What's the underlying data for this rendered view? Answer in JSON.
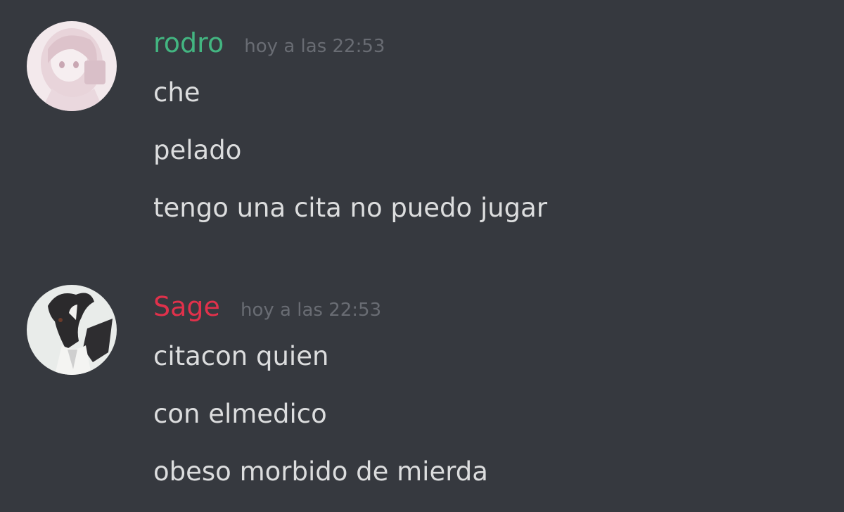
{
  "colors": {
    "background": "#36393f",
    "message_text": "#dcddde",
    "timestamp": "#72767d"
  },
  "messages": [
    {
      "author": "rodro",
      "author_color": "#43b581",
      "avatar_icon": "anime-girl-avatar-icon",
      "timestamp": "hoy a las 22:53",
      "lines": [
        "che",
        "pelado",
        "tengo una cita no puedo jugar"
      ]
    },
    {
      "author": "Sage",
      "author_color": "#e0314b",
      "avatar_icon": "anime-character-avatar-icon",
      "timestamp": "hoy a las 22:53",
      "lines": [
        "citacon quien",
        "con elmedico",
        "obeso morbido de mierda"
      ]
    }
  ]
}
